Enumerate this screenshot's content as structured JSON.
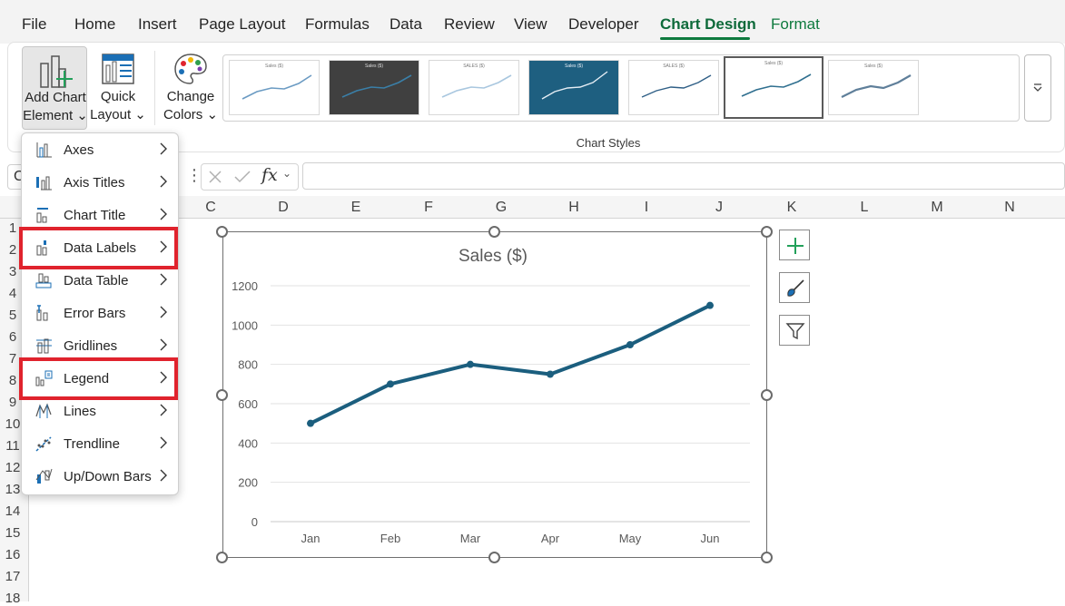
{
  "menu_tabs": [
    "File",
    "Home",
    "Insert",
    "Page Layout",
    "Formulas",
    "Data",
    "Review",
    "View",
    "Developer",
    "Chart Design",
    "Format"
  ],
  "active_tab": "Chart Design",
  "ribbon": {
    "add_chart_element": {
      "line1": "Add Chart",
      "line2": "Element"
    },
    "quick_layout": {
      "line1": "Quick",
      "line2": "Layout"
    },
    "change_colors": {
      "line1": "Change",
      "line2": "Colors"
    },
    "group_label": "Chart Styles",
    "style_thumb_titles": [
      "Sales ($)",
      "Sales ($)",
      "SALES ($)",
      "Sales ($)",
      "SALES ($)",
      "Sales ($)",
      "Sales ($)"
    ]
  },
  "formula_bar": {
    "name_box": "C",
    "fx": "fx",
    "value": ""
  },
  "columns": [
    "C",
    "D",
    "E",
    "F",
    "G",
    "H",
    "I",
    "J",
    "K",
    "L",
    "M",
    "N"
  ],
  "rows": [
    "1",
    "2",
    "3",
    "4",
    "5",
    "6",
    "7",
    "8",
    "9",
    "10",
    "11",
    "12",
    "13",
    "14",
    "15",
    "16",
    "17",
    "18"
  ],
  "dropdown_menu": [
    {
      "label": "Axes",
      "icon": "axes-icon",
      "highlighted": false
    },
    {
      "label": "Axis Titles",
      "icon": "axis-titles-icon",
      "highlighted": false
    },
    {
      "label": "Chart Title",
      "icon": "chart-title-icon",
      "highlighted": false
    },
    {
      "label": "Data Labels",
      "icon": "data-labels-icon",
      "highlighted": true
    },
    {
      "label": "Data Table",
      "icon": "data-table-icon",
      "highlighted": false
    },
    {
      "label": "Error Bars",
      "icon": "error-bars-icon",
      "highlighted": false
    },
    {
      "label": "Gridlines",
      "icon": "gridlines-icon",
      "highlighted": false
    },
    {
      "label": "Legend",
      "icon": "legend-icon",
      "highlighted": true
    },
    {
      "label": "Lines",
      "icon": "lines-icon",
      "highlighted": false
    },
    {
      "label": "Trendline",
      "icon": "trendline-icon",
      "highlighted": false
    },
    {
      "label": "Up/Down Bars",
      "icon": "up-down-bars-icon",
      "highlighted": false
    }
  ],
  "highlight_color": "#e0232d",
  "accent_color": "#0e7a3e",
  "chart_data": {
    "type": "line",
    "title": "Sales ($)",
    "categories": [
      "Jan",
      "Feb",
      "Mar",
      "Apr",
      "May",
      "Jun"
    ],
    "series": [
      {
        "values": [
          500,
          700,
          800,
          750,
          900,
          1100
        ],
        "color": "#1b5e7e"
      }
    ],
    "y_ticks": [
      "0",
      "200",
      "400",
      "600",
      "800",
      "1000",
      "1200"
    ],
    "ylim": [
      0,
      1200
    ],
    "grid": true,
    "legend": "none"
  }
}
